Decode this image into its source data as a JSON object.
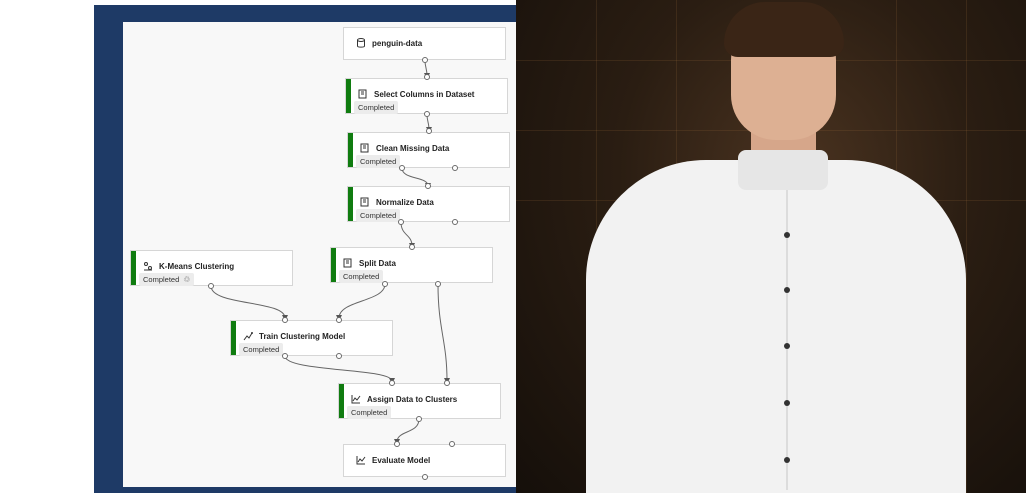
{
  "pipeline": {
    "nodes": [
      {
        "id": "penguin",
        "title": "penguin-data",
        "status": "",
        "icon": "database-icon",
        "has_bar": false
      },
      {
        "id": "select",
        "title": "Select Columns in Dataset",
        "status": "Completed",
        "icon": "module-icon",
        "has_bar": true
      },
      {
        "id": "clean",
        "title": "Clean Missing Data",
        "status": "Completed",
        "icon": "module-icon",
        "has_bar": true
      },
      {
        "id": "normalize",
        "title": "Normalize Data",
        "status": "Completed",
        "icon": "module-icon",
        "has_bar": true
      },
      {
        "id": "kmeans",
        "title": "K-Means Clustering",
        "status": "Completed",
        "icon": "cluster-icon",
        "has_bar": true,
        "reused": true
      },
      {
        "id": "split",
        "title": "Split Data",
        "status": "Completed",
        "icon": "module-icon",
        "has_bar": true
      },
      {
        "id": "train",
        "title": "Train Clustering Model",
        "status": "Completed",
        "icon": "train-icon",
        "has_bar": true
      },
      {
        "id": "assign",
        "title": "Assign Data to Clusters",
        "status": "Completed",
        "icon": "chart-icon",
        "has_bar": true
      },
      {
        "id": "evaluate",
        "title": "Evaluate Model",
        "status": "",
        "icon": "chart-icon",
        "has_bar": false
      }
    ]
  },
  "colors": {
    "frame": "#1e3a66",
    "completed_bar": "#107c10"
  }
}
